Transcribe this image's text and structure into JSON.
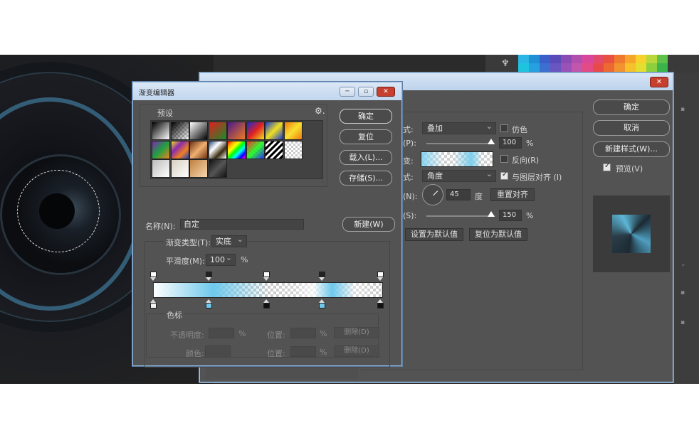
{
  "swatches": [
    "#2ab5e5",
    "#1f8fd6",
    "#3a5fc8",
    "#5b4bb8",
    "#8a4cb4",
    "#b04fae",
    "#d8479a",
    "#e24a6c",
    "#e8503f",
    "#ef7a2d",
    "#f4a52a",
    "#f7d22d",
    "#b9d63a",
    "#5dc14a",
    "#1ec4df",
    "#27a0e0",
    "#3c6fd0",
    "#6a56c0",
    "#9952b8",
    "#c256ad",
    "#e34b84",
    "#e84a4a",
    "#ec6a32",
    "#f29330",
    "#f6c12b",
    "#e3de30",
    "#8ccf3e",
    "#3bb44b"
  ],
  "layer_style": {
    "close": "✕",
    "mode_label": "式:",
    "mode_value": "叠加",
    "dither_label": "仿色",
    "opacity_label": "(P):",
    "opacity_value": "100",
    "opacity_unit": "%",
    "gradient_label": "变:",
    "reverse_label": "反向(R)",
    "style_label": "式:",
    "style_value": "角度",
    "align_label": "与图层对齐 (I)",
    "angle_label": "(N):",
    "angle_value": "45",
    "angle_unit": "度",
    "reset_align": "重置对齐",
    "scale_label": "(S):",
    "scale_value": "150",
    "scale_unit": "%",
    "set_default": "设置为默认值",
    "reset_default": "复位为默认值",
    "ok": "确定",
    "cancel": "取消",
    "new_style": "新建样式(W)...",
    "preview_label": "预览(V)",
    "opacity_fraction": 1.0,
    "scale_fraction": 1.0
  },
  "gradient_editor": {
    "title": "渐变编辑器",
    "minimize": "─",
    "maximize": "▫",
    "close": "✕",
    "presets_label": "预设",
    "gear": "⚙.",
    "ok": "确定",
    "reset": "复位",
    "load": "载入(L)...",
    "save": "存储(S)...",
    "name_label": "名称(N):",
    "name_value": "自定",
    "new": "新建(W)",
    "type_label": "渐变类型(T):",
    "type_value": "实底",
    "smooth_label": "平滑度(M):",
    "smooth_value": "100",
    "smooth_unit": "%",
    "stops_label": "色标",
    "opacity_label": "不透明度:",
    "opacity_unit": "%",
    "location_label": "位置:",
    "location_unit": "%",
    "delete_label": "删除(D)",
    "color_label": "颜色:",
    "preset_icons": [
      "black-white",
      "black-transparent",
      "black-white-diag",
      "red-green",
      "violet-orange",
      "blue-red-yellow",
      "blue-yellow-blue",
      "orange-yellow-orange",
      "violet-green-orange",
      "yellow-violet-orange-blue",
      "copper",
      "chrome",
      "spectrum",
      "transparent-rainbow",
      "transparent-stripes",
      "neutral-density",
      "silver",
      "warm-silver",
      "copper2",
      "black-steel"
    ]
  }
}
